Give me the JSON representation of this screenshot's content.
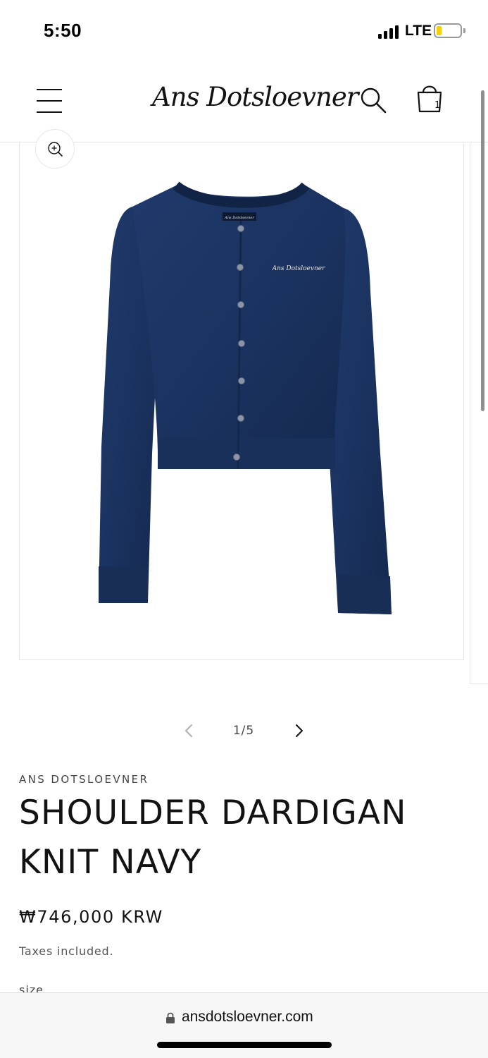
{
  "status_bar": {
    "time": "5:50",
    "network": "LTE",
    "battery_level": 0.2,
    "battery_color": "#f5cf0a"
  },
  "header": {
    "logo_text": "Ans Dotsloevner",
    "menu_icon": "hamburger-menu-icon",
    "search_icon": "search-icon",
    "cart_icon": "shopping-bag-icon",
    "cart_count": "1"
  },
  "gallery": {
    "zoom_icon": "zoom-in-icon",
    "product_image_subject": "navy knit cardigan",
    "chest_embroidery": "Ans Dotsloevner",
    "neck_label": "Ans Dotsloevner",
    "current_slide": 1,
    "total_slides": 5,
    "counter_text": "1/5",
    "prev_icon": "chevron-left-icon",
    "next_icon": "chevron-right-icon",
    "knit_color": "#1b3461"
  },
  "product": {
    "vendor": "ANS DOTSLOEVNER",
    "title": "SHOULDER DARDIGAN KNIT NAVY",
    "price": "₩746,000 KRW",
    "tax_note": "Taxes included.",
    "option_label": "size"
  },
  "browser": {
    "lock_icon": "lock-icon",
    "url": "ansdotsloevner.com"
  }
}
